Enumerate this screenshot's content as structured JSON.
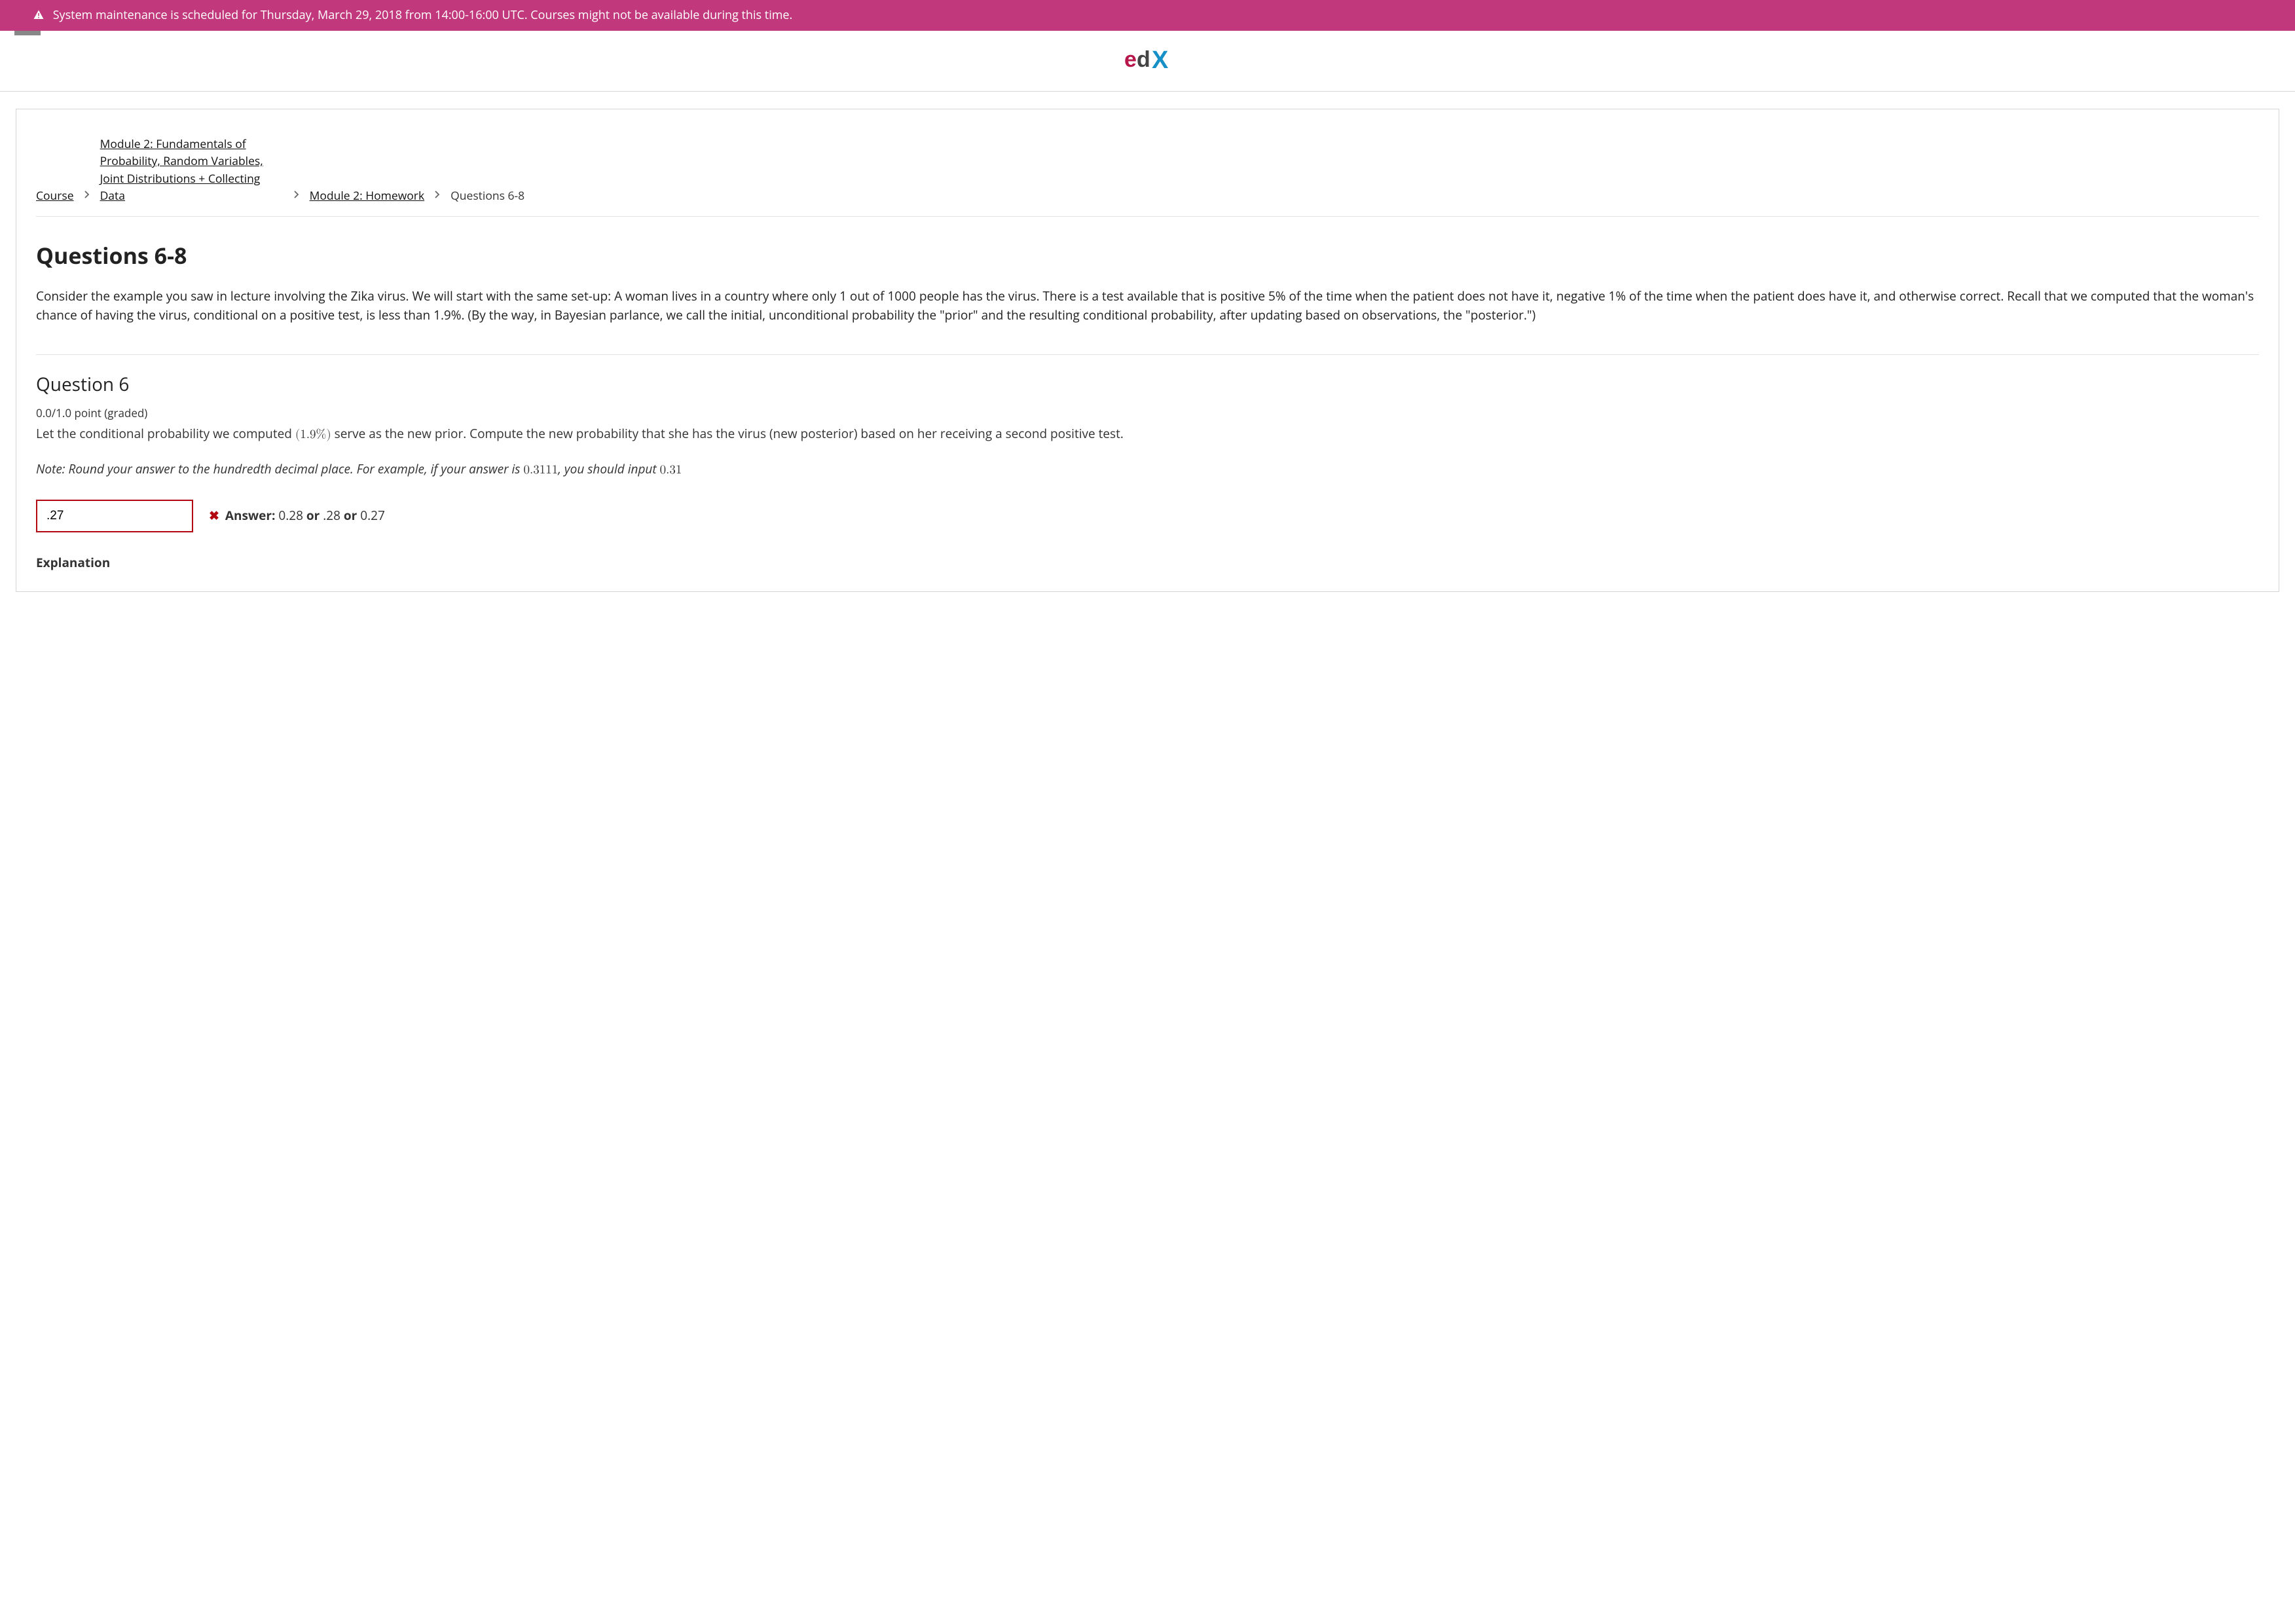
{
  "banner": {
    "text": "System maintenance is scheduled for Thursday, March 29, 2018 from 14:00-16:00 UTC. Courses might not be available during this time."
  },
  "breadcrumbs": {
    "course": "Course",
    "module": "Module 2: Fundamentals of Probability, Random Variables, Joint Distributions + Collecting Data",
    "homework": "Module 2: Homework",
    "current": "Questions 6-8"
  },
  "page": {
    "title": "Questions 6-8",
    "intro": "Consider the example you saw in lecture involving the Zika virus.  We will start with the same set-up:  A woman lives in a country where only 1 out of 1000 people has the virus. There is a test available that is positive 5% of the time when the patient does not have it, negative 1% of the time when the patient does have it, and otherwise correct.  Recall that we computed that the woman's chance of having the virus, conditional on a positive test, is less than 1.9%.  (By the way, in Bayesian parlance, we call the initial, unconditional probability the \"prior\" and the resulting conditional probability, after updating based on observations, the \"posterior.\")"
  },
  "q6": {
    "title": "Question 6",
    "grade": "0.0/1.0 point (graded)",
    "prompt_a": "Let the conditional probability we computed ",
    "prompt_math": "(1.9%)",
    "prompt_b": " serve as the new prior. Compute the new probability that she has the virus (new posterior) based on her receiving a second positive test.",
    "note_a": "Note: Round your answer to the hundredth decimal place. For example, if your answer is ",
    "note_math1": "0.3111",
    "note_b": ", you should input ",
    "note_math2": "0.31",
    "input_value": ".27",
    "answer_label": "Answer:",
    "answer_v1": "0.28",
    "or": "or",
    "answer_v2": ".28",
    "answer_v3": "0.27",
    "explanation_label": "Explanation"
  }
}
